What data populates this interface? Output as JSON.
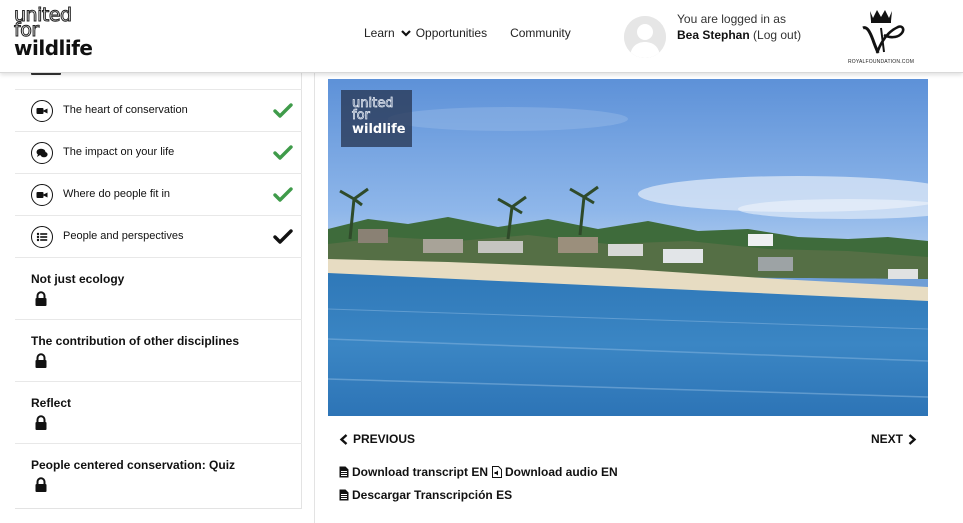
{
  "header": {
    "logo_top": "united",
    "logo_mid": "for",
    "logo_bottom": "wildlife",
    "nav": {
      "learn": "Learn",
      "opportunities": "Opportunities",
      "community": "Community"
    },
    "user": {
      "status_text": "You are logged in as",
      "name": "Bea Stephan",
      "logout": "(Log out)"
    },
    "partner_caption": "ROYALFOUNDATION.COM"
  },
  "sidebar": {
    "subitems": [
      {
        "label": "The heart of conservation",
        "icon": "video-camera-icon",
        "check_color": "#3f9b4a"
      },
      {
        "label": "The impact on your life",
        "icon": "chat-bubbles-icon",
        "check_color": "#3f9b4a"
      },
      {
        "label": "Where do people fit in",
        "icon": "video-camera-icon",
        "check_color": "#3f9b4a"
      },
      {
        "label": "People and perspectives",
        "icon": "list-icon",
        "check_color": "#111111"
      }
    ],
    "lessons": [
      {
        "label": "Not just ecology"
      },
      {
        "label": "The contribution of other disciplines"
      },
      {
        "label": "Reflect"
      },
      {
        "label": "People centered conservation: Quiz"
      }
    ]
  },
  "video": {
    "logo_top": "united",
    "logo_mid": "for",
    "logo_bottom": "wildlife"
  },
  "pager": {
    "previous": "PREVIOUS",
    "next": "NEXT"
  },
  "downloads": {
    "transcript_en": "Download transcript EN",
    "audio_en": "Download audio EN",
    "transcript_es": "Descargar Transcripción ES"
  }
}
